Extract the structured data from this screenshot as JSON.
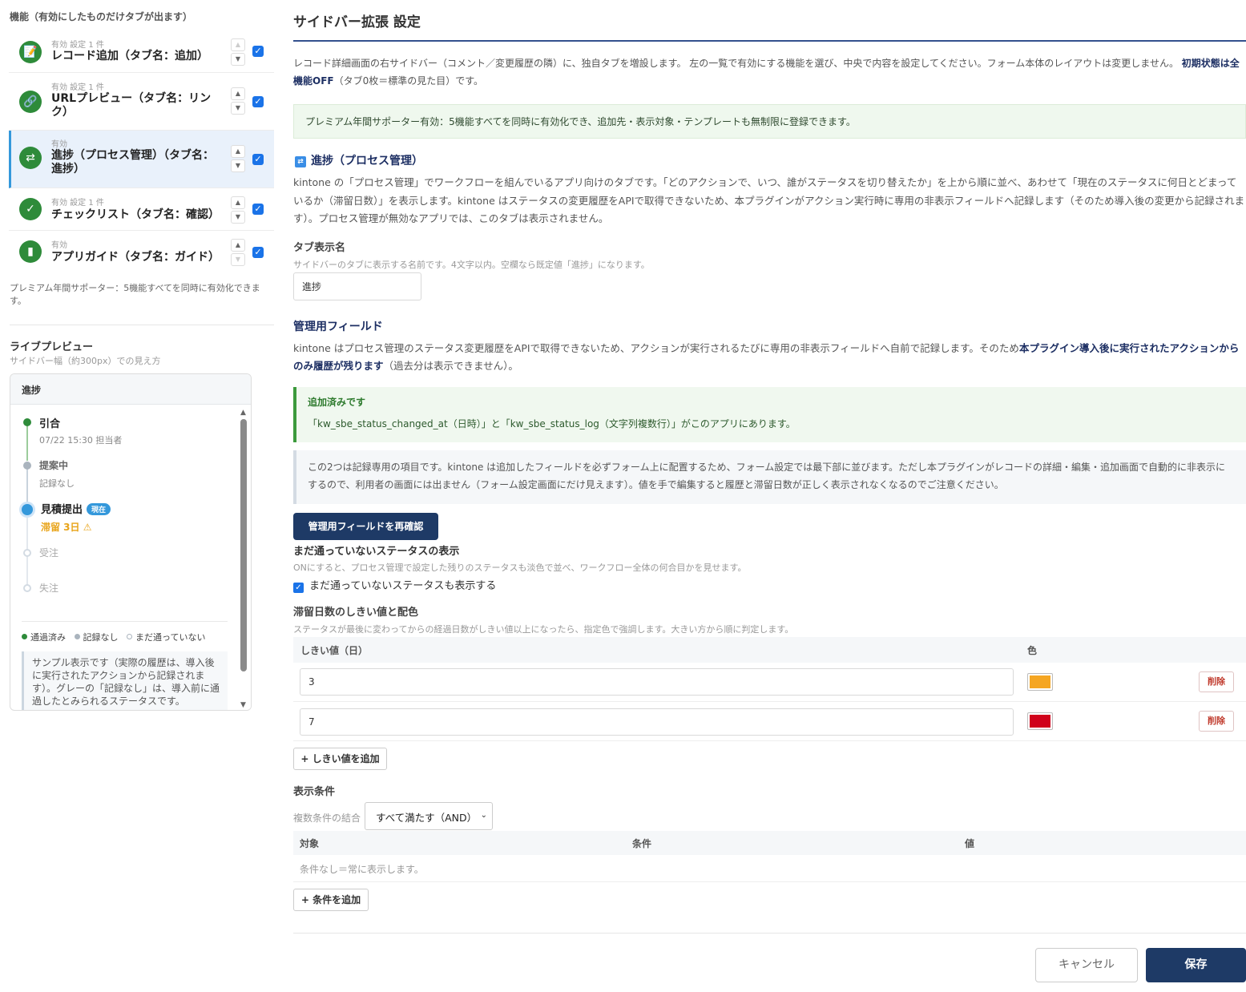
{
  "sidebar": {
    "section_title": "機能（有効にしたものだけタブが出ます）",
    "features": [
      {
        "meta": "有効 設定 1 件",
        "name": "レコード追加（タブ名：追加）",
        "icon": "edit-note-icon",
        "glyph": "📝"
      },
      {
        "meta": "有効 設定 1 件",
        "name": "URLプレビュー（タブ名：リンク）",
        "icon": "link-icon",
        "glyph": "🔗"
      },
      {
        "meta": "有効",
        "name": "進捗（プロセス管理）（タブ名：進捗）",
        "icon": "shuffle-icon",
        "glyph": "⇄"
      },
      {
        "meta": "有効 設定 1 件",
        "name": "チェックリスト（タブ名：確認）",
        "icon": "checkbox-icon",
        "glyph": "✓"
      },
      {
        "meta": "有効",
        "name": "アプリガイド（タブ名：ガイド）",
        "icon": "book-icon",
        "glyph": "▮"
      }
    ],
    "note": "プレミアム年間サポーター：5機能すべてを同時に有効化できます。",
    "preview_title": "ライブプレビュー",
    "preview_subtitle": "サイドバー幅（約300px）での見え方",
    "preview": {
      "tab": "進捗",
      "steps": [
        {
          "label": "引合",
          "meta": "07/22 15:30 担当者",
          "state": "passed"
        },
        {
          "label": "提案中",
          "meta": "記録なし",
          "state": "no-record"
        },
        {
          "label": "見積提出",
          "badge": "現在",
          "meta": "滞留 3日 ⚠",
          "state": "current"
        },
        {
          "label": "受注",
          "state": "future"
        },
        {
          "label": "失注",
          "state": "future"
        }
      ],
      "legend": [
        "通過済み",
        "記録なし",
        "まだ通っていない"
      ],
      "sample": "サンプル表示です（実際の履歴は、導入後に実行されたアクションから記録されます）。グレーの「記録なし」は、導入前に通過したとみられるステータスです。"
    }
  },
  "main": {
    "title": "サイドバー拡張 設定",
    "desc_pre": "レコード詳細画面の右サイドバー（コメント／変更履歴の隣）に、独自タブを増設します。 左の一覧で有効にする機能を選び、中央で内容を設定してください。フォーム本体のレイアウトは変更しません。 ",
    "desc_bold": "初期状態は全機能OFF",
    "desc_post": "（タブ0枚＝標準の見た目）です。",
    "premium": "プレミアム年間サポーター有効：5機能すべてを同時に有効化でき、追加先・表示対象・テンプレートも無制限に登録できます。",
    "section_title": "進捗（プロセス管理）",
    "section_desc": "kintone の「プロセス管理」でワークフローを組んでいるアプリ向けのタブです。「どのアクションで、いつ、誰がステータスを切り替えたか」を上から順に並べ、あわせて「現在のステータスに何日とどまっているか（滞留日数）」を表示します。kintone はステータスの変更履歴をAPIで取得できないため、本プラグインがアクション実行時に専用の非表示フィールドへ記録します（そのため導入後の変更から記録されます）。プロセス管理が無効なアプリでは、このタブは表示されません。",
    "tab_name_label": "タブ表示名",
    "tab_name_hint": "サイドバーのタブに表示する名前です。4文字以内。空欄なら既定値「進捗」になります。",
    "tab_name_value": "進捗",
    "mgmt_title": "管理用フィールド",
    "mgmt_desc_pre": "kintone はプロセス管理のステータス変更履歴をAPIで取得できないため、アクションが実行されるたびに専用の非表示フィールドへ自前で記録します。そのため",
    "mgmt_desc_bold": "本プラグイン導入後に実行されたアクションからのみ履歴が残ります",
    "mgmt_desc_post": "（過去分は表示できません）。",
    "ok_title": "追加済みです",
    "ok_msg": "「kw_sbe_status_changed_at（日時）」と「kw_sbe_status_log（文字列複数行）」がこのアプリにあります。",
    "info": "この2つは記録専用の項目です。kintone は追加したフィールドを必ずフォーム上に配置するため、フォーム設定では最下部に並びます。ただし本プラグインがレコードの詳細・編集・追加画面で自動的に非表示にするので、利用者の画面には出ません（フォーム設定画面にだけ見えます）。値を手で編集すると履歴と滞留日数が正しく表示されなくなるのでご注意ください。",
    "recheck_button": "管理用フィールドを再確認",
    "pending_title": "まだ通っていないステータスの表示",
    "pending_hint": "ONにすると、プロセス管理で設定した残りのステータスも淡色で並べ、ワークフロー全体の何合目かを見せます。",
    "pending_check": "まだ通っていないステータスも表示する",
    "threshold_title": "滞留日数のしきい値と配色",
    "threshold_hint": "ステータスが最後に変わってからの経過日数がしきい値以上になったら、指定色で強調します。大きい方から順に判定します。",
    "threshold_cols": [
      "しきい値（日）",
      "色"
    ],
    "thresholds": [
      {
        "days": "3",
        "color": "#f5a623",
        "delete": "削除"
      },
      {
        "days": "7",
        "color": "#d0021b",
        "delete": "削除"
      }
    ],
    "add_threshold": "+ しきい値を追加",
    "cond_title": "表示条件",
    "cond_join_label": "複数条件の結合",
    "cond_join_value": "すべて満たす（AND）",
    "cond_cols": [
      "対象",
      "条件",
      "値"
    ],
    "cond_empty": "条件なし＝常に表示します。",
    "add_condition": "+ 条件を追加",
    "cancel": "キャンセル",
    "save": "保存"
  }
}
